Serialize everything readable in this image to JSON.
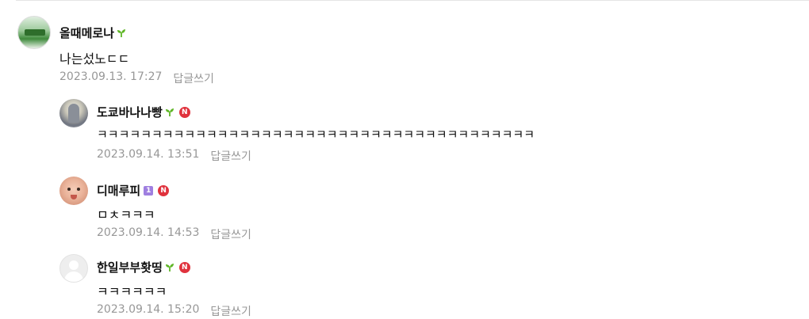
{
  "comments": [
    {
      "nickname": "올때메로나",
      "badges": [
        "sprout"
      ],
      "text": "나는섰노ㄷㄷ",
      "date": "2023.09.13. 17:27",
      "reply_label": "답글쓰기"
    },
    {
      "nickname": "도쿄바나나빵",
      "badges": [
        "sprout",
        "n"
      ],
      "text": "ㅋㅋㅋㅋㅋㅋㅋㅋㅋㅋㅋㅋㅋㅋㅋㅋㅋㅋㅋㅋㅋㅋㅋㅋㅋㅋㅋㅋㅋㅋㅋㅋㅋㅋㅋㅋㅋㅋㅋㅋ",
      "date": "2023.09.14. 13:51",
      "reply_label": "답글쓰기"
    },
    {
      "nickname": "디매루피",
      "badges": [
        "level-1",
        "n"
      ],
      "text": "ㅁㅊㅋㅋㅋ",
      "date": "2023.09.14. 14:53",
      "reply_label": "답글쓰기"
    },
    {
      "nickname": "한일부부홧띵",
      "badges": [
        "sprout",
        "n"
      ],
      "text": "ㅋㅋㅋㅋㅋㅋ",
      "date": "2023.09.14. 15:20",
      "reply_label": "답글쓰기"
    }
  ],
  "badge_glyphs": {
    "n": "N",
    "level_1": "1"
  },
  "colors": {
    "meta_text": "#979797",
    "n_badge": "#e0323d",
    "sprout": "#5fb626",
    "level_badge": "#9f7fe0"
  }
}
